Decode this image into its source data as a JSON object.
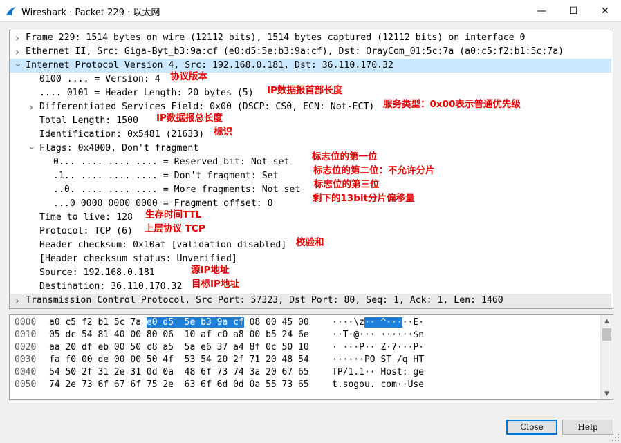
{
  "window": {
    "title": "Wireshark · Packet 229 · 以太网",
    "minimize_glyph": "—",
    "maximize_glyph": "☐",
    "close_glyph": "✕"
  },
  "tree": [
    {
      "indent": 0,
      "toggle": "collapsed",
      "text": "Frame 229: 1514 bytes on wire (12112 bits), 1514 bytes captured (12112 bits) on interface 0",
      "highlight": "none"
    },
    {
      "indent": 0,
      "toggle": "collapsed",
      "text": "Ethernet II, Src: Giga-Byt_b3:9a:cf (e0:d5:5e:b3:9a:cf), Dst: OrayCom_01:5c:7a (a0:c5:f2:b1:5c:7a)",
      "highlight": "none"
    },
    {
      "indent": 0,
      "toggle": "expanded",
      "text": "Internet Protocol Version 4, Src: 192.168.0.181, Dst: 36.110.170.32",
      "highlight": "selected"
    },
    {
      "indent": 1,
      "toggle": "none",
      "text": "0100 .... = Version: 4",
      "highlight": "none",
      "annotation": "协议版本"
    },
    {
      "indent": 1,
      "toggle": "none",
      "text": ".... 0101 = Header Length: 20 bytes (5)",
      "highlight": "none",
      "annotation": "IP数据报首部长度"
    },
    {
      "indent": 1,
      "toggle": "collapsed",
      "text": "Differentiated Services Field: 0x00 (DSCP: CS0, ECN: Not-ECT)",
      "highlight": "none",
      "annotation": "服务类型：0x00表示普通优先级"
    },
    {
      "indent": 1,
      "toggle": "none",
      "text": "Total Length: 1500",
      "highlight": "none",
      "annotation": "IP数据报总长度"
    },
    {
      "indent": 1,
      "toggle": "none",
      "text": "Identification: 0x5481 (21633)",
      "highlight": "none",
      "annotation": "标识"
    },
    {
      "indent": 1,
      "toggle": "expanded",
      "text": "Flags: 0x4000, Don't fragment",
      "highlight": "none"
    },
    {
      "indent": 2,
      "toggle": "none",
      "text": "0... .... .... .... = Reserved bit: Not set",
      "highlight": "none",
      "annotation": "标志位的第一位"
    },
    {
      "indent": 2,
      "toggle": "none",
      "text": ".1.. .... .... .... = Don't fragment: Set",
      "highlight": "none",
      "annotation": "标志位的第二位：不允许分片"
    },
    {
      "indent": 2,
      "toggle": "none",
      "text": "..0. .... .... .... = More fragments: Not set",
      "highlight": "none",
      "annotation": "标志位的第三位"
    },
    {
      "indent": 2,
      "toggle": "none",
      "text": "...0 0000 0000 0000 = Fragment offset: 0",
      "highlight": "none",
      "annotation": "剩下的13bit分片偏移量"
    },
    {
      "indent": 1,
      "toggle": "none",
      "text": "Time to live: 128",
      "highlight": "none",
      "annotation": "生存时间TTL"
    },
    {
      "indent": 1,
      "toggle": "none",
      "text": "Protocol: TCP (6)",
      "highlight": "none",
      "annotation": "上层协议 TCP"
    },
    {
      "indent": 1,
      "toggle": "none",
      "text": "Header checksum: 0x10af [validation disabled]",
      "highlight": "none",
      "annotation": "校验和"
    },
    {
      "indent": 1,
      "toggle": "none",
      "text": "[Header checksum status: Unverified]",
      "highlight": "none"
    },
    {
      "indent": 1,
      "toggle": "none",
      "text": "Source: 192.168.0.181",
      "highlight": "none",
      "annotation": "源IP地址"
    },
    {
      "indent": 1,
      "toggle": "none",
      "text": "Destination: 36.110.170.32",
      "highlight": "none",
      "annotation": "目标IP地址"
    },
    {
      "indent": 0,
      "toggle": "collapsed",
      "text": "Transmission Control Protocol, Src Port: 57323, Dst Port: 80, Seq: 1, Ack: 1, Len: 1460",
      "highlight": "gray"
    }
  ],
  "hex": [
    {
      "offset": "0000",
      "bytes_pre": "a0 c5 f2 b1 5c 7a ",
      "bytes_hl": "e0 d5  5e b3 9a cf",
      "bytes_post": " 08 00 45 00",
      "ascii_pre": "····\\z",
      "ascii_hl": "·· ^···",
      "ascii_post": "··E·"
    },
    {
      "offset": "0010",
      "bytes_pre": "05 dc 54 81 40 00 80 06  10 af c0 a8 00 b5 24 6e",
      "bytes_hl": "",
      "bytes_post": "",
      "ascii_pre": "··T·@··· ······$n",
      "ascii_hl": "",
      "ascii_post": ""
    },
    {
      "offset": "0020",
      "bytes_pre": "aa 20 df eb 00 50 c8 a5  5a e6 37 a4 8f 0c 50 10",
      "bytes_hl": "",
      "bytes_post": "",
      "ascii_pre": "· ···P·· Z·7···P·",
      "ascii_hl": "",
      "ascii_post": ""
    },
    {
      "offset": "0030",
      "bytes_pre": "fa f0 00 de 00 00 50 4f  53 54 20 2f 71 20 48 54",
      "bytes_hl": "",
      "bytes_post": "",
      "ascii_pre": "······PO ST /q HT",
      "ascii_hl": "",
      "ascii_post": ""
    },
    {
      "offset": "0040",
      "bytes_pre": "54 50 2f 31 2e 31 0d 0a  48 6f 73 74 3a 20 67 65",
      "bytes_hl": "",
      "bytes_post": "",
      "ascii_pre": "TP/1.1·· Host: ge",
      "ascii_hl": "",
      "ascii_post": ""
    },
    {
      "offset": "0050",
      "bytes_pre": "74 2e 73 6f 67 6f 75 2e  63 6f 6d 0d 0a 55 73 65",
      "bytes_hl": "",
      "bytes_post": "",
      "ascii_pre": "t.sogou. com··Use",
      "ascii_hl": "",
      "ascii_post": ""
    }
  ],
  "buttons": {
    "close": "Close",
    "help": "Help"
  },
  "colors": {
    "selected_row": "#cce8ff",
    "annotation": "#e00000",
    "hex_highlight": "#1e7fd8"
  }
}
